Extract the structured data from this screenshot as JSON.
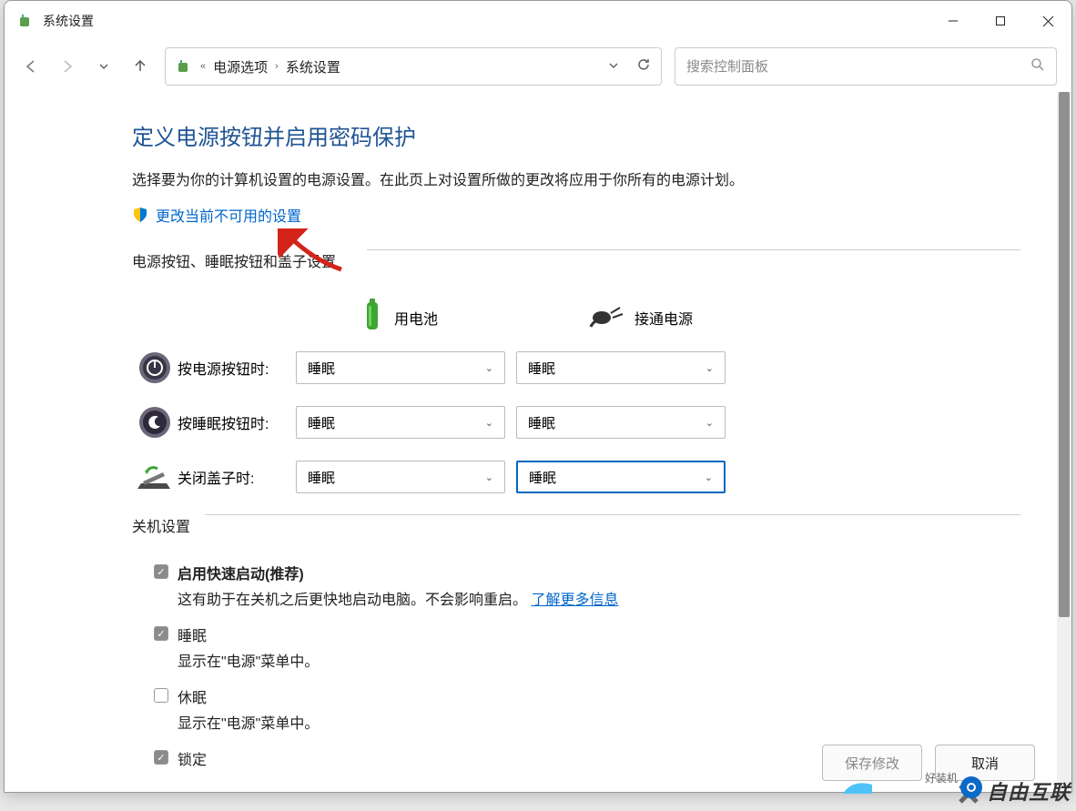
{
  "window": {
    "title": "系统设置"
  },
  "breadcrumb": {
    "back_chev": "«",
    "items": [
      "电源选项",
      "系统设置"
    ]
  },
  "search": {
    "placeholder": "搜索控制面板"
  },
  "page": {
    "heading": "定义电源按钮并启用密码保护",
    "desc": "选择要为你的计算机设置的电源设置。在此页上对设置所做的更改将应用于你所有的电源计划。",
    "admin_link": "更改当前不可用的设置"
  },
  "group1": {
    "label": "电源按钮、睡眠按钮和盖子设置",
    "col_battery": "用电池",
    "col_plugged": "接通电源",
    "rows": [
      {
        "label": "按电源按钮时:",
        "battery": "睡眠",
        "plugged": "睡眠"
      },
      {
        "label": "按睡眠按钮时:",
        "battery": "睡眠",
        "plugged": "睡眠"
      },
      {
        "label": "关闭盖子时:",
        "battery": "睡眠",
        "plugged": "睡眠"
      }
    ]
  },
  "group2": {
    "label": "关机设置",
    "items": [
      {
        "title": "启用快速启动(推荐)",
        "bold": true,
        "checked": true,
        "sub": "这有助于在关机之后更快地启动电脑。不会影响重启。",
        "link": "了解更多信息"
      },
      {
        "title": "睡眠",
        "checked": true,
        "sub": "显示在\"电源\"菜单中。"
      },
      {
        "title": "休眠",
        "checked": false,
        "sub": "显示在\"电源\"菜单中。"
      },
      {
        "title": "锁定",
        "checked": true,
        "sub": ""
      }
    ]
  },
  "footer": {
    "save": "保存修改",
    "cancel": "取消"
  },
  "watermark": {
    "a": "自由互联",
    "b": "好装机"
  }
}
